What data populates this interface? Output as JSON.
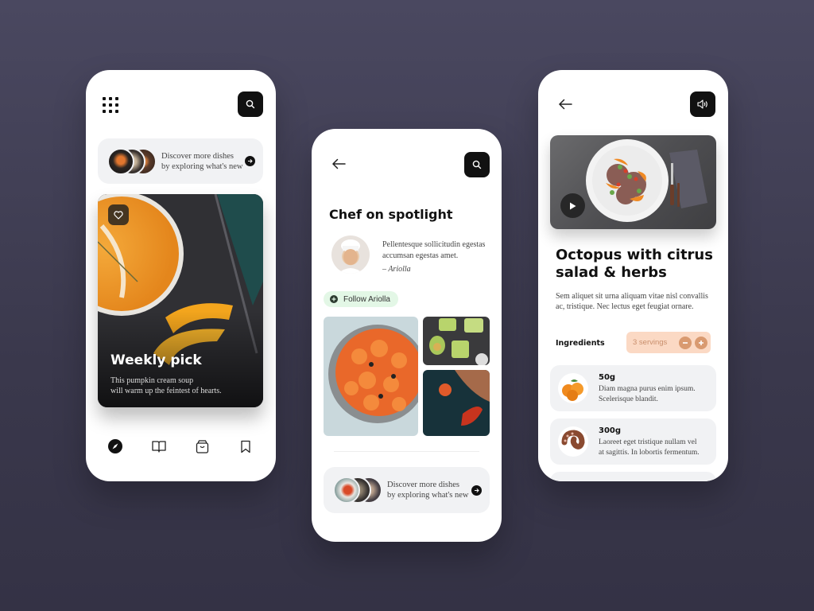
{
  "colors": {
    "background_top": "#4a4860",
    "background_bottom": "#343245",
    "dark_button": "#111111",
    "follow_bg": "#e3f7e6",
    "servings_bg": "#fbd9c4",
    "servings_accent": "#d99a70"
  },
  "screen1": {
    "menu_icon": "grid-icon",
    "search_icon": "search-icon",
    "discover": {
      "line1": "Discover more dishes",
      "line2": "by exploring what's new"
    },
    "weekly": {
      "title": "Weekly pick",
      "desc_line1": "This pumpkin cream soup",
      "desc_line2": "will warm up the feintest of hearts."
    },
    "tabbar": [
      {
        "name": "explore",
        "icon": "compass-icon",
        "active": true
      },
      {
        "name": "recipes",
        "icon": "book-icon",
        "active": false
      },
      {
        "name": "shop",
        "icon": "bag-icon",
        "active": false
      },
      {
        "name": "saved",
        "icon": "bookmark-icon",
        "active": false
      }
    ]
  },
  "screen2": {
    "title": "Chef on spotlight",
    "quote_line1": "Pellentesque sollicitudin egestas",
    "quote_line2": "accumsan egestas amet.",
    "signature": "– Ariolla",
    "follow_label": "Follow Ariolla",
    "discover": {
      "line1": "Discover more dishes",
      "line2": "by exploring what's new"
    }
  },
  "screen3": {
    "title_line1": "Octopus with citrus",
    "title_line2": "salad & herbs",
    "desc_line1": "Sem aliquet sit urna aliquam vitae nisl convallis",
    "desc_line2": "ac, tristique. Nec lectus eget feugiat ornare.",
    "ingredients_label": "Ingredients",
    "servings_label": "3 servings",
    "servings_count": 3,
    "ingredients": [
      {
        "amount": "50g",
        "line1": "Diam magna purus enim ipsum.",
        "line2": "Scelerisque blandit."
      },
      {
        "amount": "300g",
        "line1": "Laoreet eget tristique nullam vel",
        "line2": "at sagittis. In lobortis fermentum."
      }
    ]
  }
}
